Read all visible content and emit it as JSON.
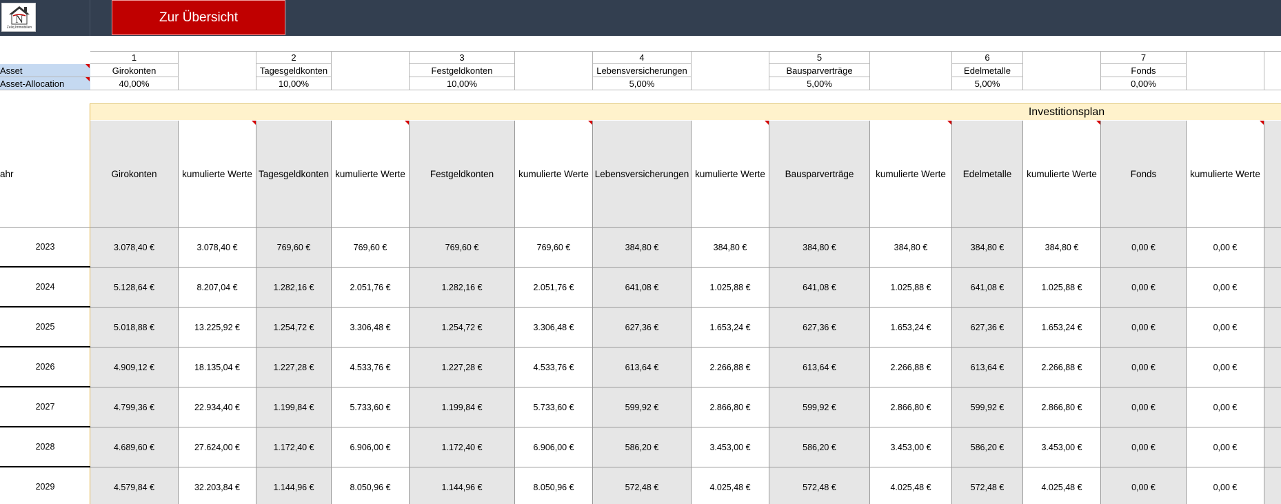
{
  "logo": {
    "text": "Zeliq Immobilien"
  },
  "toolbar": {
    "overview_label": "Zur Übersicht"
  },
  "rows": {
    "asset_label": "Asset",
    "allocation_label": "Asset-Allocation"
  },
  "assets": [
    {
      "num": "1",
      "name": "Girokonten",
      "alloc": "40,00%"
    },
    {
      "num": "2",
      "name": "Tagesgeldkonten",
      "alloc": "10,00%"
    },
    {
      "num": "3",
      "name": "Festgeldkonten",
      "alloc": "10,00%"
    },
    {
      "num": "4",
      "name": "Lebensversicherungen",
      "alloc": "5,00%"
    },
    {
      "num": "5",
      "name": "Bausparverträge",
      "alloc": "5,00%"
    },
    {
      "num": "6",
      "name": "Edelmetalle",
      "alloc": "5,00%"
    },
    {
      "num": "7",
      "name": "Fonds",
      "alloc": "0,00%"
    }
  ],
  "plan": {
    "title": "Investitionsplan",
    "year_header": "ahr",
    "columns": [
      "Girokonten",
      "kumulierte Werte",
      "Tagesgeldkonten",
      "kumulierte Werte",
      "Festgeldkonten",
      "kumulierte Werte",
      "Lebensversicherungen",
      "kumulierte Werte",
      "Bausparverträge",
      "kumulierte Werte",
      "Edelmetalle",
      "kumulierte Werte",
      "Fonds",
      "kumulierte Werte"
    ],
    "rows": [
      {
        "year": "2023",
        "values": [
          "3.078,40 €",
          "3.078,40 €",
          "769,60 €",
          "769,60 €",
          "769,60 €",
          "769,60 €",
          "384,80 €",
          "384,80 €",
          "384,80 €",
          "384,80 €",
          "384,80 €",
          "384,80 €",
          "0,00 €",
          "0,00 €"
        ]
      },
      {
        "year": "2024",
        "values": [
          "5.128,64 €",
          "8.207,04 €",
          "1.282,16 €",
          "2.051,76 €",
          "1.282,16 €",
          "2.051,76 €",
          "641,08 €",
          "1.025,88 €",
          "641,08 €",
          "1.025,88 €",
          "641,08 €",
          "1.025,88 €",
          "0,00 €",
          "0,00 €"
        ]
      },
      {
        "year": "2025",
        "values": [
          "5.018,88 €",
          "13.225,92 €",
          "1.254,72 €",
          "3.306,48 €",
          "1.254,72 €",
          "3.306,48 €",
          "627,36 €",
          "1.653,24 €",
          "627,36 €",
          "1.653,24 €",
          "627,36 €",
          "1.653,24 €",
          "0,00 €",
          "0,00 €"
        ]
      },
      {
        "year": "2026",
        "values": [
          "4.909,12 €",
          "18.135,04 €",
          "1.227,28 €",
          "4.533,76 €",
          "1.227,28 €",
          "4.533,76 €",
          "613,64 €",
          "2.266,88 €",
          "613,64 €",
          "2.266,88 €",
          "613,64 €",
          "2.266,88 €",
          "0,00 €",
          "0,00 €"
        ]
      },
      {
        "year": "2027",
        "values": [
          "4.799,36 €",
          "22.934,40 €",
          "1.199,84 €",
          "5.733,60 €",
          "1.199,84 €",
          "5.733,60 €",
          "599,92 €",
          "2.866,80 €",
          "599,92 €",
          "2.866,80 €",
          "599,92 €",
          "2.866,80 €",
          "0,00 €",
          "0,00 €"
        ]
      },
      {
        "year": "2028",
        "values": [
          "4.689,60 €",
          "27.624,00 €",
          "1.172,40 €",
          "6.906,00 €",
          "1.172,40 €",
          "6.906,00 €",
          "586,20 €",
          "3.453,00 €",
          "586,20 €",
          "3.453,00 €",
          "586,20 €",
          "3.453,00 €",
          "0,00 €",
          "0,00 €"
        ]
      },
      {
        "year": "2029",
        "values": [
          "4.579,84 €",
          "32.203,84 €",
          "1.144,96 €",
          "8.050,96 €",
          "1.144,96 €",
          "8.050,96 €",
          "572,48 €",
          "4.025,48 €",
          "572,48 €",
          "4.025,48 €",
          "572,48 €",
          "4.025,48 €",
          "0,00 €",
          "0,00 €"
        ]
      }
    ]
  },
  "colors": {
    "topbar": "#333f50",
    "button": "#c00000",
    "label_bg": "#c5d9f1",
    "band_bg": "#fff2cc",
    "grey_cell": "#e6e6e6",
    "marker": "#d40000"
  }
}
